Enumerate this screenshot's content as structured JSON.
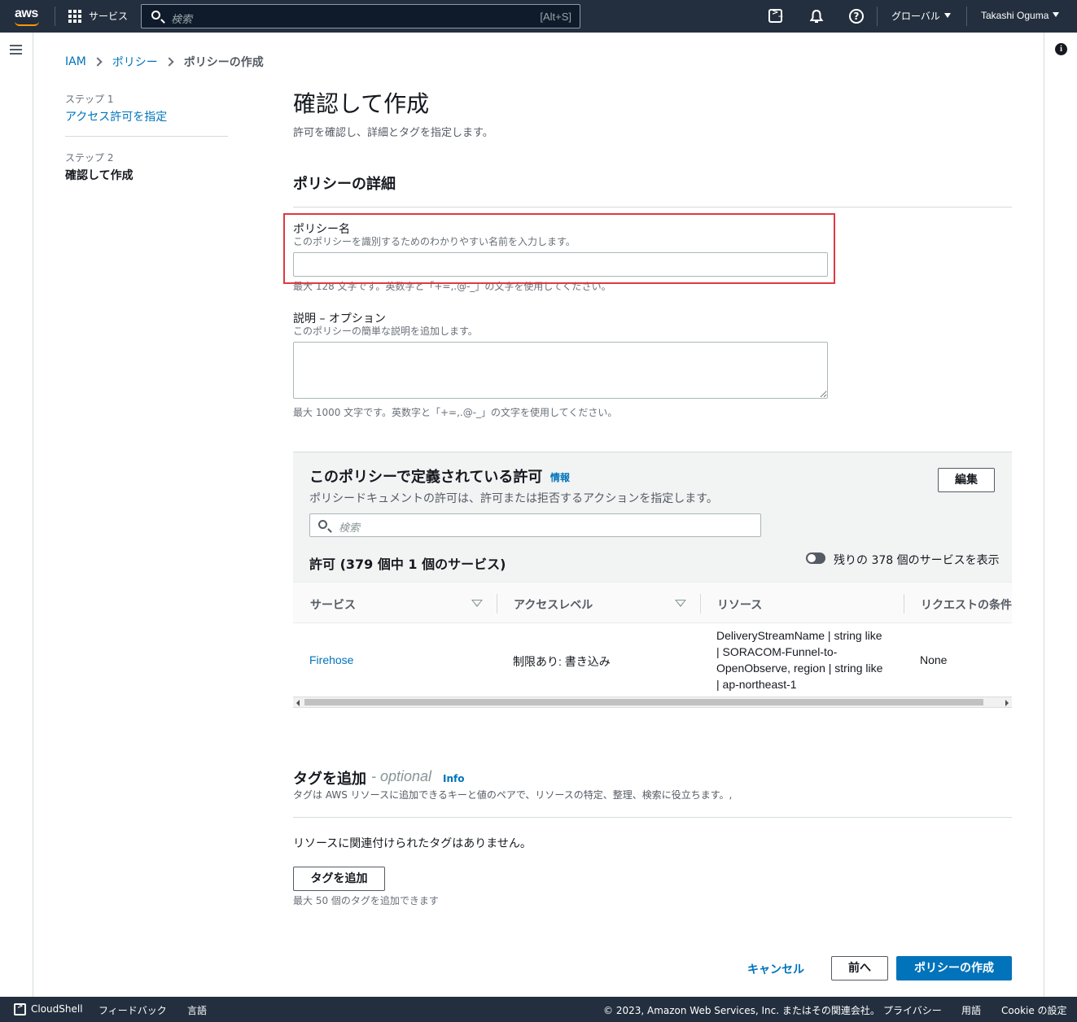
{
  "topnav": {
    "logo": "aws",
    "services_label": "サービス",
    "search_placeholder": "検索",
    "search_shortcut": "[Alt+S]",
    "region_label": "グローバル",
    "user_label": "Takashi Oguma"
  },
  "breadcrumb": {
    "items": [
      "IAM",
      "ポリシー",
      "ポリシーの作成"
    ]
  },
  "steps": {
    "step1_label": "ステップ 1",
    "step1_title": "アクセス許可を指定",
    "step2_label": "ステップ 2",
    "step2_title": "確認して作成"
  },
  "page": {
    "title": "確認して作成",
    "subtitle": "許可を確認し、詳細とタグを指定します。"
  },
  "details": {
    "section_title": "ポリシーの詳細",
    "name_label": "ポリシー名",
    "name_desc": "このポリシーを識別するためのわかりやすい名前を入力します。",
    "name_value": "",
    "name_hint": "最大 128 文字です。英数字と「+=,.@-_」の文字を使用してください。",
    "desc_label": "説明 – オプション",
    "desc_desc": "このポリシーの簡単な説明を追加します。",
    "desc_value": "",
    "desc_hint": "最大 1000 文字です。英数字と「+=,.@-_」の文字を使用してください。"
  },
  "permissions": {
    "title": "このポリシーで定義されている許可",
    "info_link": "情報",
    "description": "ポリシードキュメントの許可は、許可または拒否するアクションを指定します。",
    "edit_button": "編集",
    "search_placeholder": "検索",
    "count_label": "許可 (379 個中 1 個のサービス)",
    "toggle_label": "残りの 378 個のサービスを表示",
    "columns": [
      "サービス",
      "アクセスレベル",
      "リソース",
      "リクエストの条件"
    ],
    "rows": [
      {
        "service": "Firehose",
        "access_level": "制限あり: 書き込み",
        "resource_lines": [
          "DeliveryStreamName | string like",
          "| SORACOM-Funnel-to-",
          "OpenObserve, region | string like",
          "| ap-northeast-1"
        ],
        "condition": "None"
      }
    ]
  },
  "tags": {
    "title": "タグを追加",
    "optional": "- optional",
    "info_link": "Info",
    "description": "タグは AWS リソースに追加できるキーと値のペアで、リソースの特定、整理、検索に役立ちます。,",
    "empty_text": "リソースに関連付けられたタグはありません。",
    "add_button": "タグを追加",
    "limit_text": "最大 50 個のタグを追加できます"
  },
  "actions": {
    "cancel": "キャンセル",
    "previous": "前へ",
    "create": "ポリシーの作成"
  },
  "footer": {
    "cloudshell": "CloudShell",
    "feedback": "フィードバック",
    "language": "言語",
    "copyright": "© 2023, Amazon Web Services, Inc. またはその関連会社。",
    "privacy": "プライバシー",
    "terms": "用語",
    "cookie": "Cookie の設定"
  },
  "colors": {
    "nav_bg": "#232f3e",
    "link": "#0073bb",
    "primary_button": "#0073bb",
    "highlight_border": "#e0393e",
    "accent_orange": "#ff9900"
  }
}
